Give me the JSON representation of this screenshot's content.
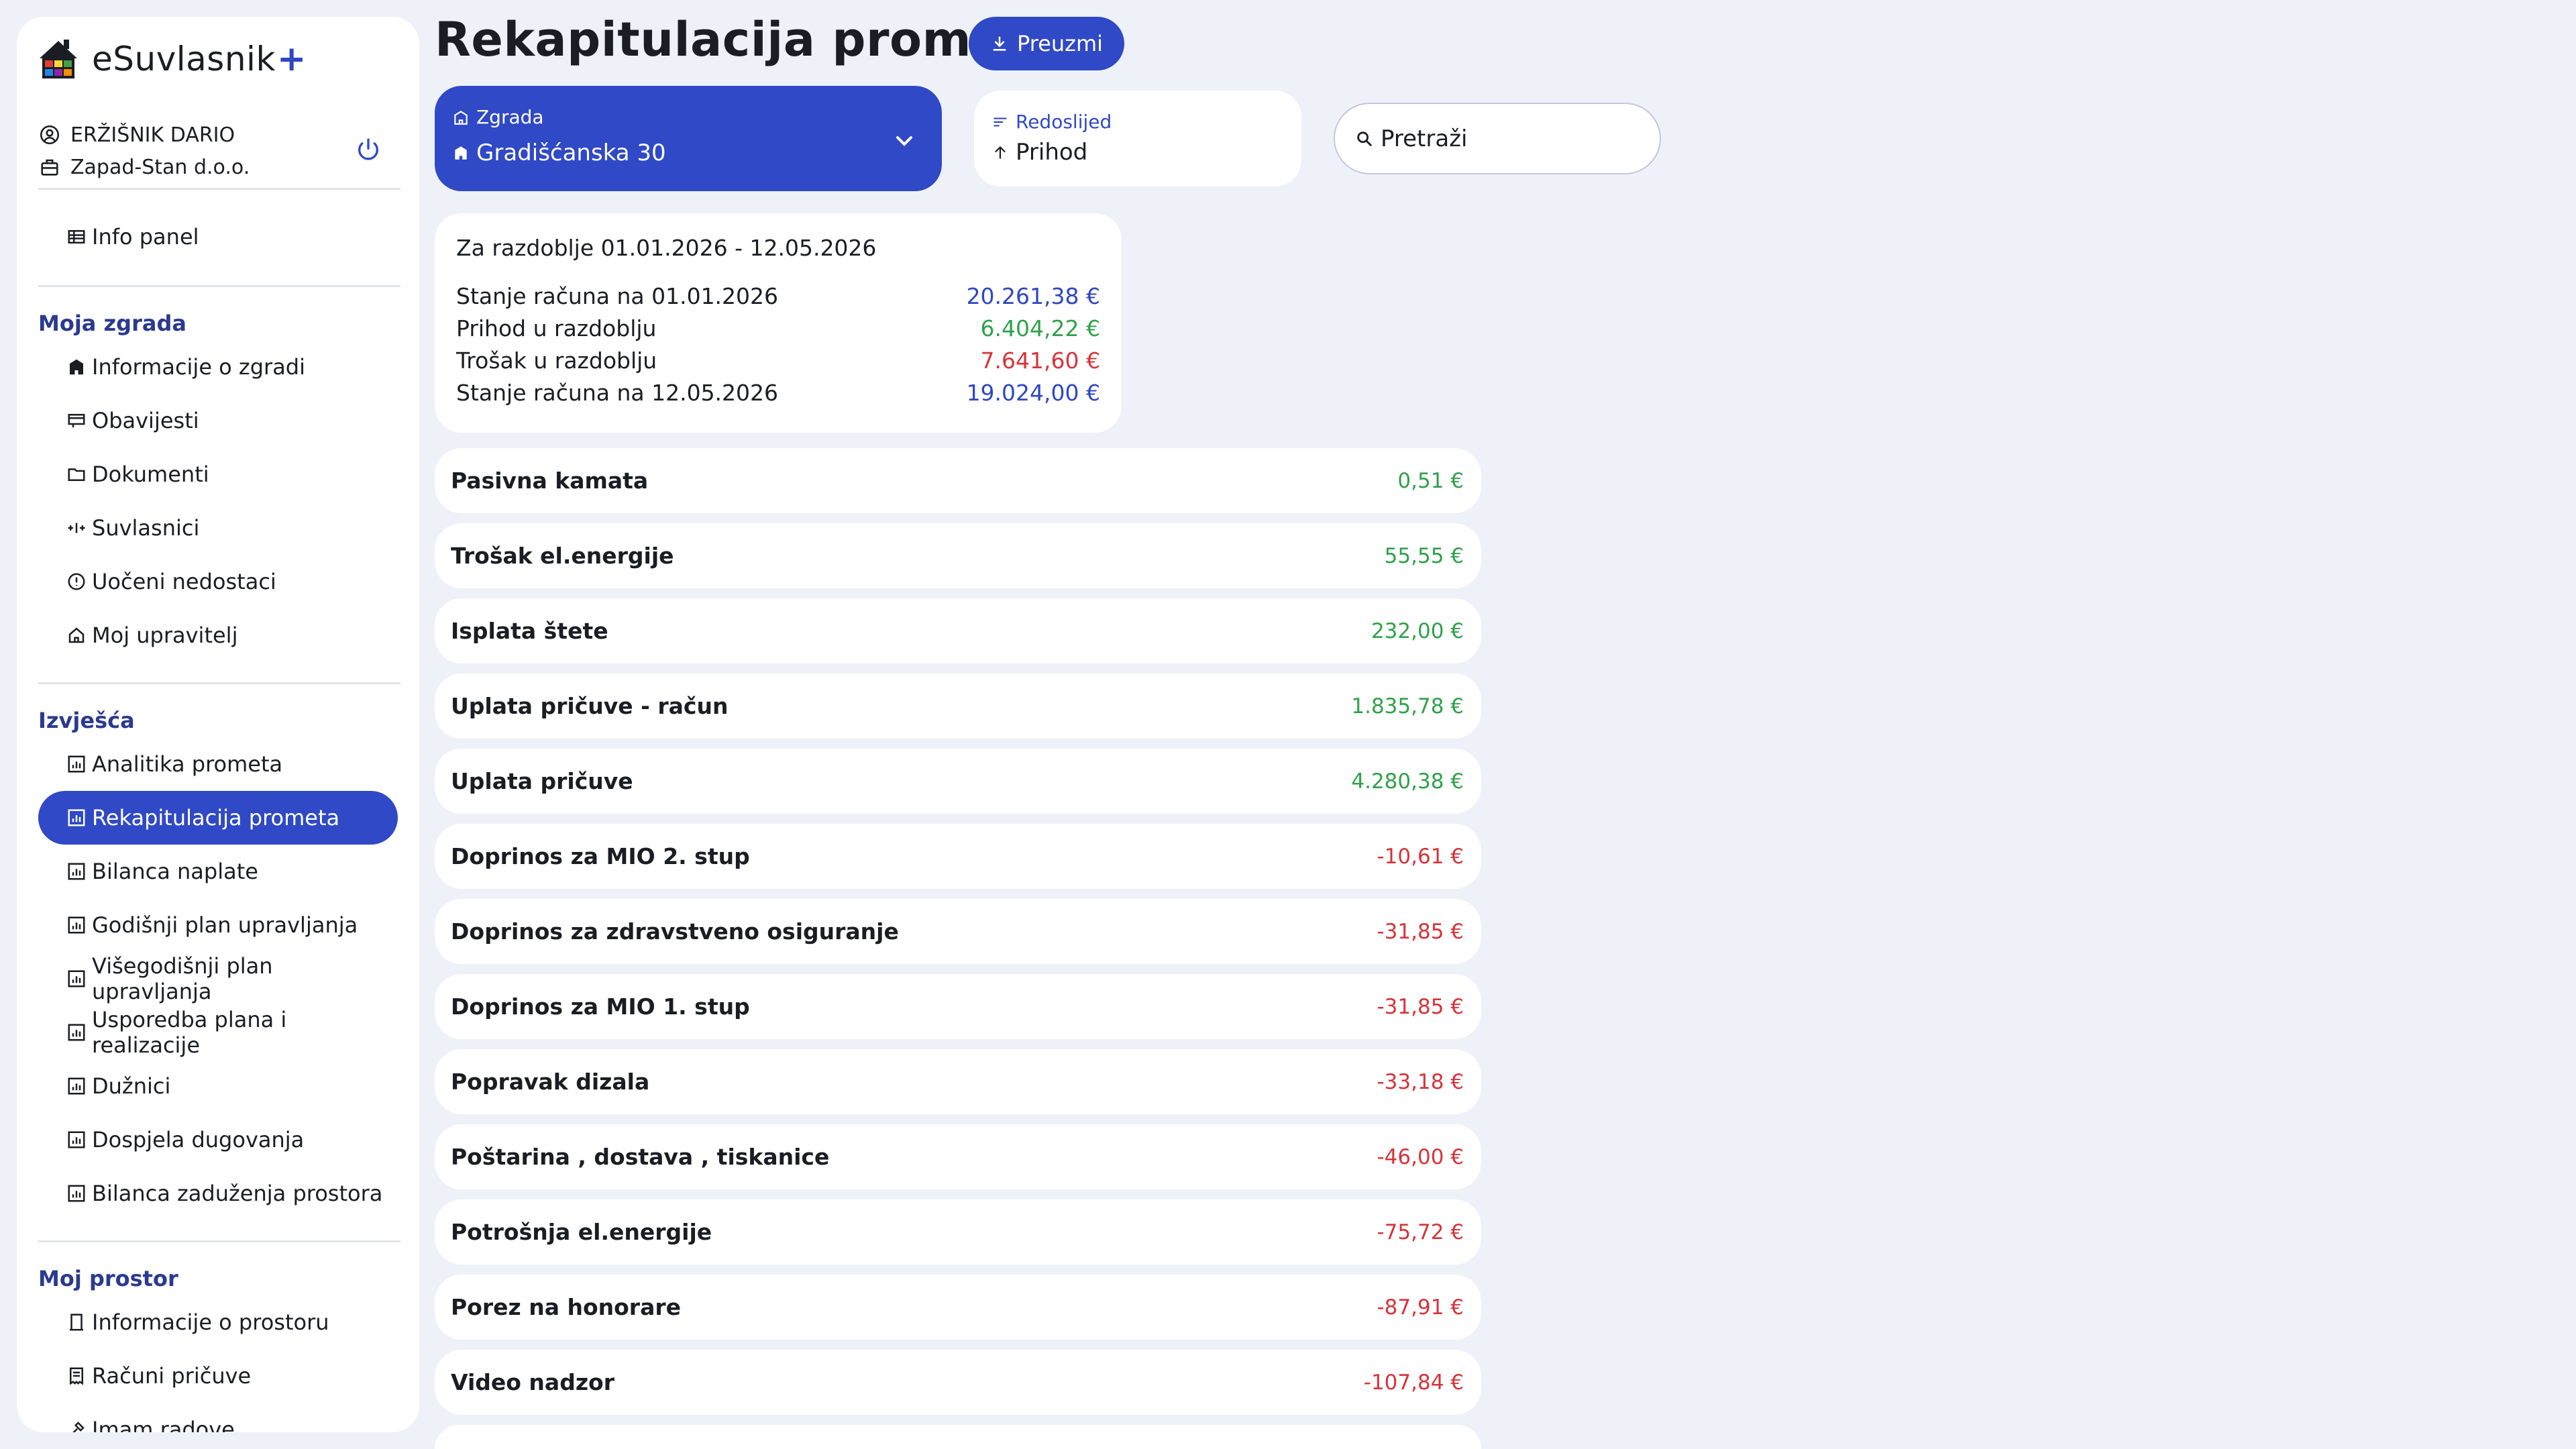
{
  "app": {
    "name": "eSuvlasnik",
    "plus": "+"
  },
  "user": {
    "name": "ERŽIŠNIK DARIO",
    "company": "Zapad-Stan d.o.o."
  },
  "icons": {
    "user": "user-circle-icon",
    "company": "briefcase-icon",
    "power": "power-icon"
  },
  "colors": {
    "accent": "#3049c6",
    "positive": "#2fa14a",
    "negative": "#d7333a",
    "section": "#2b3a8f"
  },
  "nav": {
    "info_panel": "Info panel",
    "sections": [
      {
        "title": "Moja zgrada",
        "items": [
          "Informacije o zgradi",
          "Obavijesti",
          "Dokumenti",
          "Suvlasnici",
          "Uočeni nedostaci",
          "Moj upravitelj"
        ]
      },
      {
        "title": "Izvješća",
        "items": [
          "Analitika prometa",
          "Rekapitulacija prometa",
          "Bilanca naplate",
          "Godišnji plan upravljanja",
          "Višegodišnji plan upravljanja",
          "Usporedba plana i realizacije",
          "Dužnici",
          "Dospjela dugovanja",
          "Bilanca zaduženja prostora"
        ]
      },
      {
        "title": "Moj prostor",
        "items": [
          "Informacije o prostoru",
          "Računi pričuve",
          "Imam radove"
        ]
      }
    ],
    "active": "Rekapitulacija prometa"
  },
  "header": {
    "title": "Rekapitulacija prometa",
    "download_label": "Preuzmi"
  },
  "filters": {
    "building": {
      "label": "Zgrada",
      "value": "Gradišćanska 30"
    },
    "order": {
      "label": "Redoslijed",
      "value": "Prihod"
    },
    "search": {
      "placeholder": "Pretraži"
    }
  },
  "summary": {
    "period": "Za razdoblje 01.01.2026 - 12.05.2026",
    "rows": [
      {
        "label": "Stanje računa na 01.01.2026",
        "value": "20.261,38 €",
        "kind": "balance"
      },
      {
        "label": "Prihod u razdoblju",
        "value": "6.404,22 €",
        "kind": "income"
      },
      {
        "label": "Trošak u razdoblju",
        "value": "7.641,60 €",
        "kind": "expense"
      },
      {
        "label": "Stanje računa na 12.05.2026",
        "value": "19.024,00 €",
        "kind": "balance"
      }
    ]
  },
  "transactions": [
    {
      "name": "Pasivna kamata",
      "amount": "0,51 €",
      "kind": "income"
    },
    {
      "name": "Trošak el.energije",
      "amount": "55,55 €",
      "kind": "income"
    },
    {
      "name": "Isplata štete",
      "amount": "232,00 €",
      "kind": "income"
    },
    {
      "name": "Uplata pričuve - račun",
      "amount": "1.835,78 €",
      "kind": "income"
    },
    {
      "name": "Uplata pričuve",
      "amount": "4.280,38 €",
      "kind": "income"
    },
    {
      "name": "Doprinos za MIO 2. stup",
      "amount": "-10,61 €",
      "kind": "expense"
    },
    {
      "name": "Doprinos za zdravstveno osiguranje",
      "amount": "-31,85 €",
      "kind": "expense"
    },
    {
      "name": "Doprinos za MIO 1. stup",
      "amount": "-31,85 €",
      "kind": "expense"
    },
    {
      "name": "Popravak dizala",
      "amount": "-33,18 €",
      "kind": "expense"
    },
    {
      "name": "Poštarina , dostava , tiskanice",
      "amount": "-46,00 €",
      "kind": "expense"
    },
    {
      "name": "Potrošnja el.energije",
      "amount": "-75,72 €",
      "kind": "expense"
    },
    {
      "name": "Porez na honorare",
      "amount": "-87,91 €",
      "kind": "expense"
    },
    {
      "name": "Video nadzor",
      "amount": "-107,84 €",
      "kind": "expense"
    }
  ]
}
